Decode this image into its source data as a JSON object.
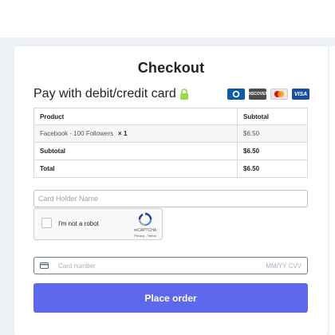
{
  "header": {
    "title": "Checkout"
  },
  "payment": {
    "heading": "Pay with debit/credit card",
    "card_logos": [
      {
        "icon": "diners-club-icon",
        "label": "D"
      },
      {
        "icon": "discover-icon",
        "label": "DISCOVER"
      },
      {
        "icon": "mastercard-icon",
        "label": ""
      },
      {
        "icon": "visa-icon",
        "label": "VISA"
      }
    ]
  },
  "order_summary": {
    "columns": [
      "Product",
      "Subtotal"
    ],
    "items": [
      {
        "product": "Facebook - 100 Followers",
        "quantity": "× 1",
        "subtotal": "$6.50"
      }
    ],
    "subtotal_label": "Subtotal",
    "subtotal_value": "$6.50",
    "total_label": "Total",
    "total_value": "$6.50"
  },
  "form": {
    "card_holder_placeholder": "Card Holder Name",
    "card_number_placeholder": "Card number",
    "card_expiry_cvv_placeholder": "MM/YY  CVV"
  },
  "recaptcha": {
    "label": "I'm not a robot",
    "brand": "reCAPTCHA",
    "links": "Privacy - Terms"
  },
  "actions": {
    "place_order_label": "Place order"
  },
  "colors": {
    "accent": "#5d68ea",
    "lock": "#9ad94f",
    "page_background": "#eef1f6"
  }
}
